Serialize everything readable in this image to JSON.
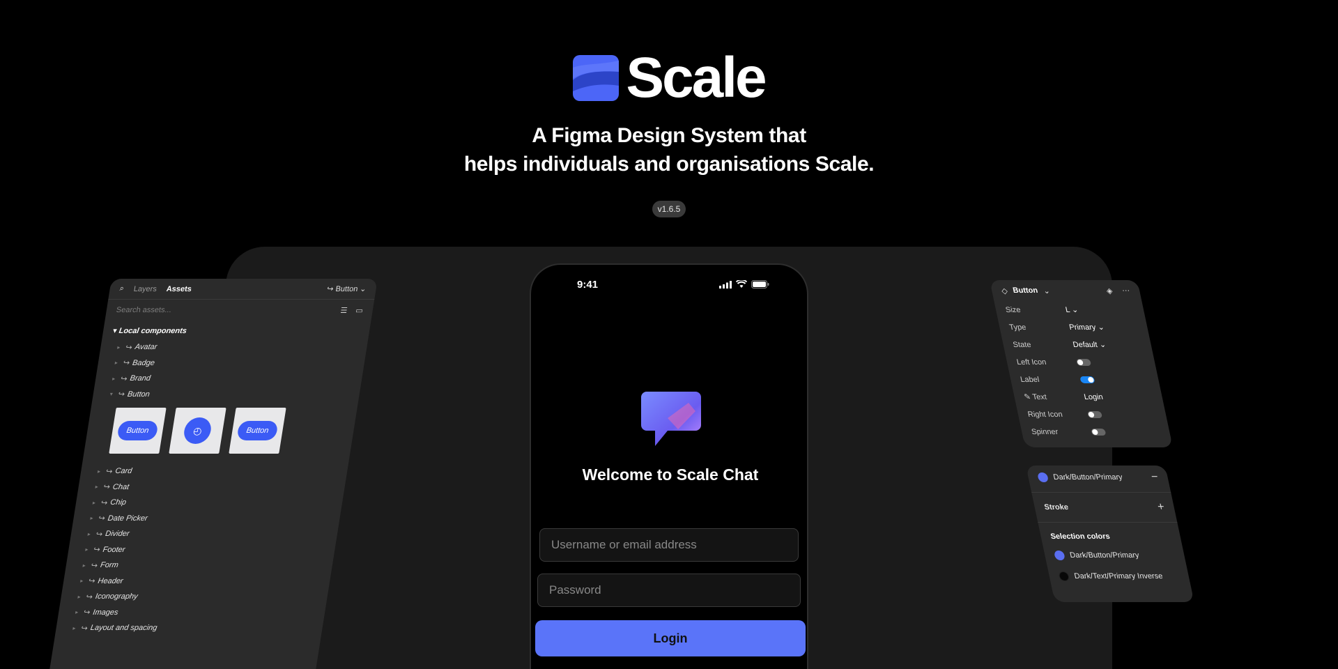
{
  "hero": {
    "logo_text": "Scale",
    "tagline_line1": "A Figma Design System that",
    "tagline_line2": "helps individuals and organisations Scale.",
    "version": "v1.6.5"
  },
  "assets_panel": {
    "tabs": [
      "Layers",
      "Assets"
    ],
    "active_tab": "Assets",
    "component_selector": "↪ Button",
    "search_placeholder": "Search assets...",
    "section_title": "Local components",
    "items_before_thumbs": [
      "Avatar",
      "Badge",
      "Brand",
      "Button"
    ],
    "thumbnail_label": "Button",
    "items_after_thumbs": [
      "Card",
      "Chat",
      "Chip",
      "Date Picker",
      "Divider",
      "Footer",
      "Form",
      "Header",
      "Iconography",
      "Images",
      "Layout and spacing"
    ]
  },
  "phone": {
    "time": "9:41",
    "welcome": "Welcome to Scale Chat",
    "username_placeholder": "Username or email address",
    "password_placeholder": "Password",
    "login_label": "Login"
  },
  "properties_panel": {
    "title": "Button",
    "rows": [
      {
        "key": "Size",
        "value": "L"
      },
      {
        "key": "Type",
        "value": "Primary"
      },
      {
        "key": "State",
        "value": "Default"
      }
    ],
    "left_icon_label": "Left Icon",
    "left_icon_on": false,
    "label_label": "Label",
    "label_on": true,
    "text_label": "Text",
    "text_value": "Login",
    "right_icon_label": "Right Icon",
    "right_icon_on": false,
    "spinner_label": "Spinner",
    "spinner_on": false
  },
  "colors_panel": {
    "fill_name": "Dark/Button/Primary",
    "stroke_label": "Stroke",
    "selection_title": "Selection colors",
    "selection_colors": [
      {
        "name": "Dark/Button/Primary",
        "color": "#5a6ef0"
      },
      {
        "name": "Dark/Text/Primary Inverse",
        "color": "#080808"
      }
    ]
  },
  "colors": {
    "accent": "#5a74f9",
    "brand_blue": "#3b5bf5",
    "background": "#000000",
    "panel": "#2b2b2b"
  }
}
